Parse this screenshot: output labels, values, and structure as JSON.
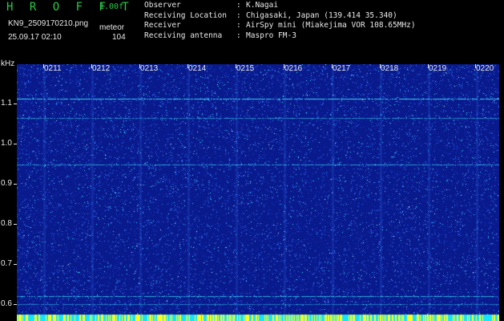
{
  "header": {
    "app_title": "H R O F F T",
    "version": "1.00f",
    "filename": "KN9_2509170210.png",
    "mode": "meteor",
    "datetime": "25.09.17 02:10",
    "count": "104",
    "info": [
      {
        "label": "Observer",
        "value": "K.Nagai"
      },
      {
        "label": "Receiving Location",
        "value": "Chigasaki, Japan (139.414 35.340)"
      },
      {
        "label": "Receiver",
        "value": "AirSpy mini (Miakejima VOR 108.65MHz)"
      },
      {
        "label": "Receiving antenna",
        "value": "Maspro FM-3"
      }
    ]
  },
  "spectrogram": {
    "y_unit": "kHz",
    "y_ticks": [
      "1.1",
      "1.0",
      "0.9",
      "0.8",
      "0.7",
      "0.6"
    ],
    "x_ticks": [
      "0211",
      "0212",
      "0213",
      "0214",
      "0215",
      "0216",
      "0217",
      "0218",
      "0219",
      "0220"
    ],
    "colors": {
      "background": "#091a8c",
      "noise": "#3a7bff",
      "signal": "#39e8ff",
      "strip": "#18e3ff",
      "strip_hot": "#ffff20"
    }
  }
}
